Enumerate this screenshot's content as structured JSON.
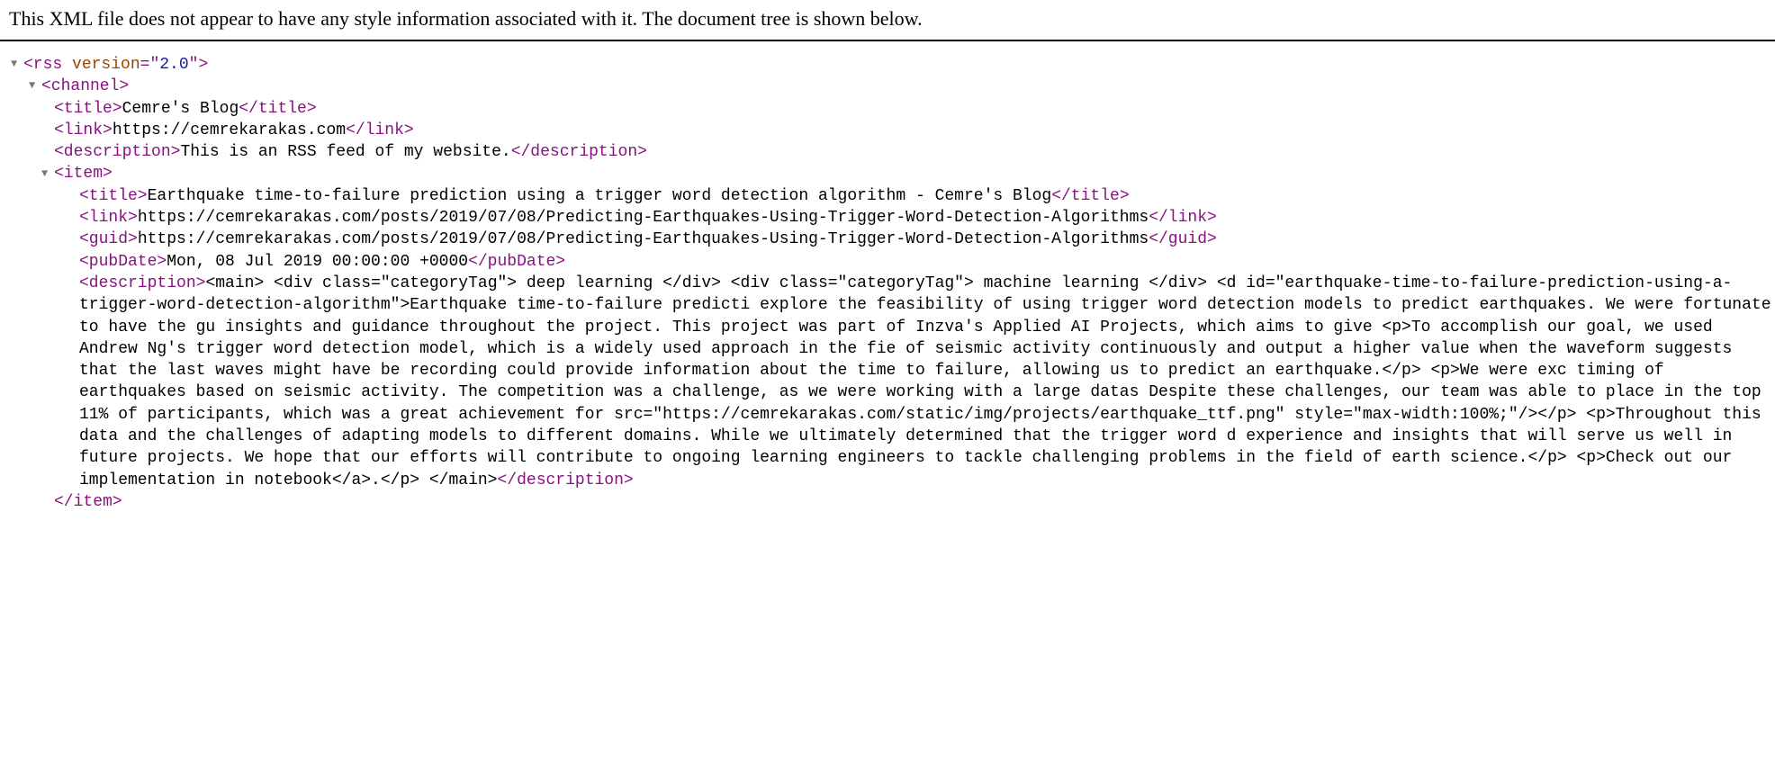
{
  "notice": "This XML file does not appear to have any style information associated with it. The document tree is shown below.",
  "rss": {
    "open": "<rss ",
    "attrName": "version",
    "eq": "=\"",
    "attrVal": "2.0",
    "close": "\">"
  },
  "channel": {
    "open": "<channel>",
    "title_open": "<title>",
    "title_text": "Cemre's Blog",
    "title_close": "</title>",
    "link_open": "<link>",
    "link_text": "https://cemrekarakas.com",
    "link_close": "</link>",
    "desc_open": "<description>",
    "desc_text": "This is an RSS feed of my website.",
    "desc_close": "</description>"
  },
  "item": {
    "open": "<item>",
    "close": "</item>",
    "title_open": "<title>",
    "title_text": "Earthquake time-to-failure prediction using a trigger word detection algorithm - Cemre's Blog",
    "title_close": "</title>",
    "link_open": "<link>",
    "link_text": "https://cemrekarakas.com/posts/2019/07/08/Predicting-Earthquakes-Using-Trigger-Word-Detection-Algorithms",
    "link_close": "</link>",
    "guid_open": "<guid>",
    "guid_text": "https://cemrekarakas.com/posts/2019/07/08/Predicting-Earthquakes-Using-Trigger-Word-Detection-Algorithms",
    "guid_close": "</guid>",
    "pub_open": "<pubDate>",
    "pub_text": "Mon, 08 Jul 2019 00:00:00 +0000",
    "pub_close": "</pubDate>",
    "d_open": "<description>",
    "d_text": "<main> <div class=\"categoryTag\"> deep learning </div> <div class=\"categoryTag\"> machine learning </div> <d id=\"earthquake-time-to-failure-prediction-using-a-trigger-word-detection-algorithm\">Earthquake time-to-failure predicti explore the feasibility of using trigger word detection models to predict earthquakes. We were fortunate to have the gu insights and guidance throughout the project. This project was part of Inzva's Applied AI Projects, which aims to give <p>To accomplish our goal, we used Andrew Ng's trigger word detection model, which is a widely used approach in the fie of seismic activity continuously and output a higher value when the waveform suggests that the last waves might have be recording could provide information about the time to failure, allowing us to predict an earthquake.</p> <p>We were exc timing of earthquakes based on seismic activity. The competition was a challenge, as we were working with a large datas Despite these challenges, our team was able to place in the top 11% of participants, which was a great achievement for src=\"https://cemrekarakas.com/static/img/projects/earthquake_ttf.png\" style=\"max-width:100%;\"/></p> <p>Throughout this data and the challenges of adapting models to different domains. While we ultimately determined that the trigger word d experience and insights that will serve us well in future projects. We hope that our efforts will contribute to ongoing learning engineers to tackle challenging problems in the field of earth science.</p> <p>Check out our implementation in notebook</a>.</p> </main>",
    "d_close": "</description>"
  }
}
